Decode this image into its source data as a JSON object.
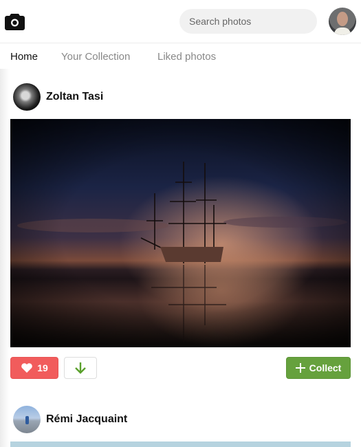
{
  "header": {
    "logo_icon": "camera-icon",
    "search": {
      "placeholder": "Search photos",
      "value": ""
    },
    "user_avatar": "user-avatar"
  },
  "nav": {
    "tabs": [
      {
        "label": "Home",
        "active": true
      },
      {
        "label": "Your Collection",
        "active": false
      },
      {
        "label": "Liked photos",
        "active": false
      }
    ]
  },
  "feed": {
    "posts": [
      {
        "author": "Zoltan Tasi",
        "photo_subject": "sailing ship at dusk reflected in water",
        "likes": "19",
        "like_icon": "heart-icon",
        "download_icon": "arrow-down-icon",
        "collect_label": "Collect",
        "collect_icon": "plus-icon"
      },
      {
        "author": "Rémi Jacquaint",
        "photo_subject": "pale blue sky landscape"
      }
    ]
  },
  "colors": {
    "like": "#f15c5c",
    "collect": "#66a13d",
    "download_arrow": "#5aa02c",
    "search_bg": "#f1f1f1"
  }
}
